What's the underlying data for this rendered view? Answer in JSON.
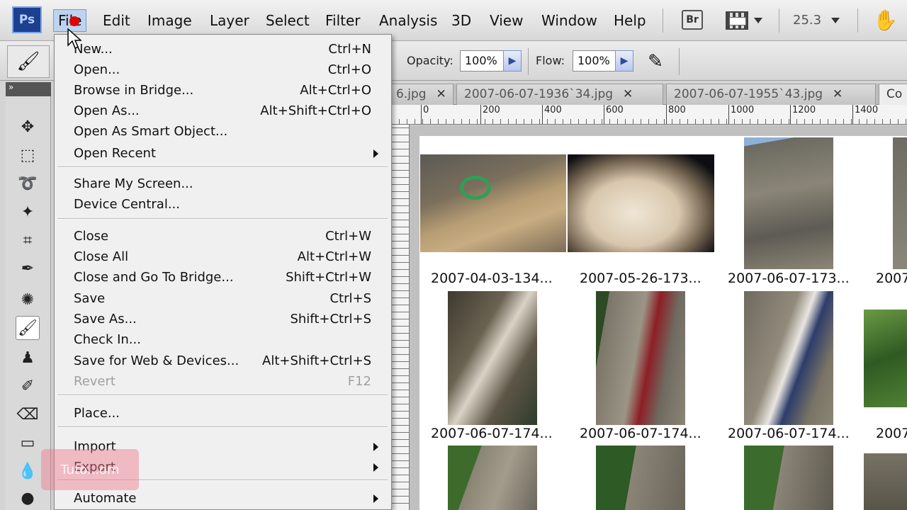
{
  "app": {
    "logo": "Ps"
  },
  "menubar": {
    "items": [
      "File",
      "Edit",
      "Image",
      "Layer",
      "Select",
      "Filter",
      "Analysis",
      "3D",
      "View",
      "Window",
      "Help"
    ],
    "bridge_label": "Br",
    "zoom": "25.3"
  },
  "options": {
    "opacity_label": "Opacity:",
    "opacity_value": "100%",
    "flow_label": "Flow:",
    "flow_value": "100%"
  },
  "tabs": [
    {
      "label": "6.jpg"
    },
    {
      "label": "2007-06-07-1936`34.jpg"
    },
    {
      "label": "2007-06-07-1955`43.jpg"
    },
    {
      "label": "Co"
    }
  ],
  "ruler": {
    "ticks": [
      "0",
      "200",
      "400",
      "600",
      "800",
      "1000",
      "1200",
      "1400"
    ]
  },
  "file_menu": {
    "items": [
      {
        "label": "New...",
        "shortcut": "Ctrl+N"
      },
      {
        "label": "Open...",
        "shortcut": "Ctrl+O"
      },
      {
        "label": "Browse in Bridge...",
        "shortcut": "Alt+Ctrl+O"
      },
      {
        "label": "Open As...",
        "shortcut": "Alt+Shift+Ctrl+O"
      },
      {
        "label": "Open As Smart Object...",
        "shortcut": ""
      },
      {
        "label": "Open Recent",
        "shortcut": "",
        "submenu": true
      },
      {
        "label": "Share My Screen...",
        "shortcut": ""
      },
      {
        "label": "Device Central...",
        "shortcut": ""
      },
      {
        "label": "Close",
        "shortcut": "Ctrl+W"
      },
      {
        "label": "Close All",
        "shortcut": "Alt+Ctrl+W"
      },
      {
        "label": "Close and Go To Bridge...",
        "shortcut": "Shift+Ctrl+W"
      },
      {
        "label": "Save",
        "shortcut": "Ctrl+S"
      },
      {
        "label": "Save As...",
        "shortcut": "Shift+Ctrl+S"
      },
      {
        "label": "Check In...",
        "shortcut": ""
      },
      {
        "label": "Save for Web & Devices...",
        "shortcut": "Alt+Shift+Ctrl+S"
      },
      {
        "label": "Revert",
        "shortcut": "F12",
        "disabled": true
      },
      {
        "label": "Place...",
        "shortcut": ""
      },
      {
        "label": "Import",
        "shortcut": "",
        "submenu": true
      },
      {
        "label": "Export",
        "shortcut": "",
        "submenu": true
      },
      {
        "label": "Automate",
        "shortcut": "",
        "submenu": true
      }
    ]
  },
  "contact_sheet": {
    "row1": [
      "2007-04-03-134...",
      "2007-05-26-173...",
      "2007-06-07-173...",
      "2007"
    ],
    "row2": [
      "2007-06-07-174...",
      "2007-06-07-174...",
      "2007-06-07-174...",
      "2007"
    ]
  },
  "watermark": "Tuto...om"
}
